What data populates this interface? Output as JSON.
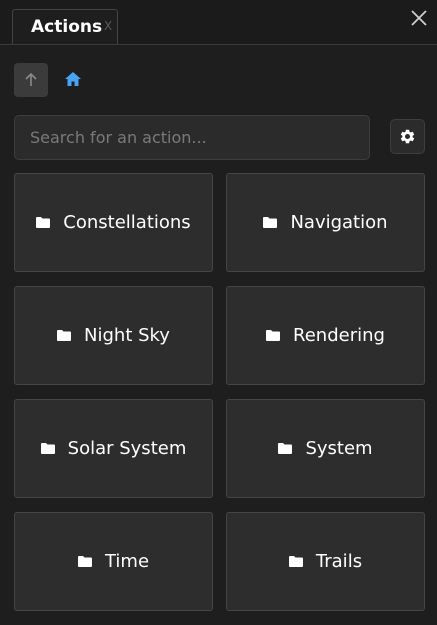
{
  "panel": {
    "tab_label": "Actions",
    "tab_close_label": "X"
  },
  "toolbar": {
    "up_icon": "arrow-up-icon",
    "home_icon": "home-icon",
    "settings_icon": "gear-icon"
  },
  "search": {
    "placeholder": "Search for an action...",
    "value": ""
  },
  "folders": [
    {
      "label": "Constellations",
      "icon": "folder-icon"
    },
    {
      "label": "Navigation",
      "icon": "folder-icon"
    },
    {
      "label": "Night Sky",
      "icon": "folder-icon"
    },
    {
      "label": "Rendering",
      "icon": "folder-icon"
    },
    {
      "label": "Solar System",
      "icon": "folder-icon"
    },
    {
      "label": "System",
      "icon": "folder-icon"
    },
    {
      "label": "Time",
      "icon": "folder-icon"
    },
    {
      "label": "Trails",
      "icon": "folder-icon"
    }
  ],
  "colors": {
    "background": "#1e1e1e",
    "tile": "#2d2d2d",
    "home_accent": "#4aa3f0",
    "text": "#ffffff"
  }
}
